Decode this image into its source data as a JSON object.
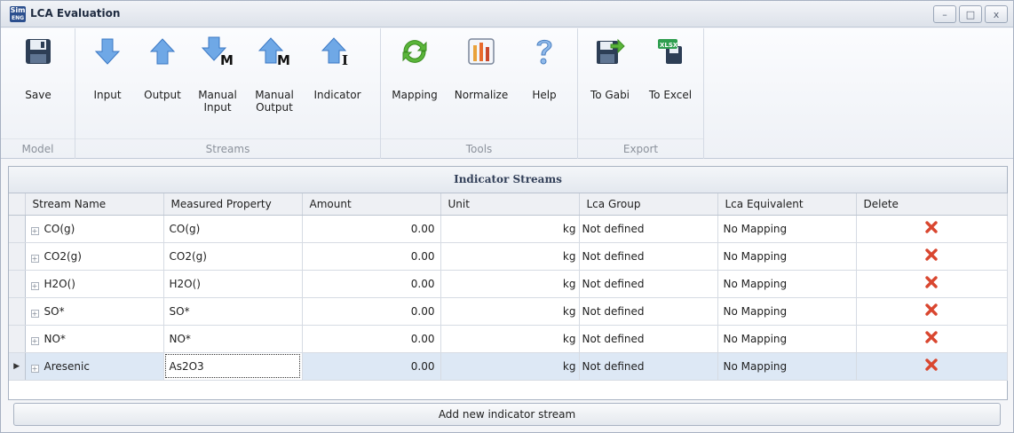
{
  "window": {
    "app_logo_top": "Sim",
    "app_logo_bottom": "ENG",
    "title": "LCA Evaluation"
  },
  "ribbon": {
    "groups": [
      {
        "caption": "Model",
        "buttons": [
          {
            "label": "Save",
            "icon": "save-icon"
          }
        ]
      },
      {
        "caption": "Streams",
        "buttons": [
          {
            "label": "Input",
            "icon": "arrow-down-icon"
          },
          {
            "label": "Output",
            "icon": "arrow-up-icon"
          },
          {
            "label": "Manual\nInput",
            "icon": "arrow-down-m-icon"
          },
          {
            "label": "Manual\nOutput",
            "icon": "arrow-up-m-icon"
          },
          {
            "label": "Indicator",
            "icon": "arrow-up-i-icon"
          }
        ]
      },
      {
        "caption": "Tools",
        "buttons": [
          {
            "label": "Mapping",
            "icon": "refresh-icon"
          },
          {
            "label": "Normalize",
            "icon": "bar-chart-icon"
          },
          {
            "label": "Help",
            "icon": "question-icon"
          }
        ]
      },
      {
        "caption": "Export",
        "buttons": [
          {
            "label": "To Gabi",
            "icon": "save-export-icon"
          },
          {
            "label": "To Excel",
            "icon": "excel-icon"
          }
        ]
      }
    ],
    "m_letter": "M",
    "i_letter": "I",
    "excel_badge": "XLSX"
  },
  "grid": {
    "title": "Indicator Streams",
    "columns": [
      "Stream Name",
      "Measured Property",
      "Amount",
      "Unit",
      "Lca Group",
      "Lca Equivalent",
      "Delete"
    ],
    "rows": [
      {
        "stream": "CO(g)",
        "property": "CO(g)",
        "amount": "0.00",
        "unit": "kg",
        "group": "Not defined",
        "equivalent": "No Mapping"
      },
      {
        "stream": "CO2(g)",
        "property": "CO2(g)",
        "amount": "0.00",
        "unit": "kg",
        "group": "Not defined",
        "equivalent": "No Mapping"
      },
      {
        "stream": "H2O()",
        "property": "H2O()",
        "amount": "0.00",
        "unit": "kg",
        "group": "Not defined",
        "equivalent": "No Mapping"
      },
      {
        "stream": "SO*",
        "property": "SO*",
        "amount": "0.00",
        "unit": "kg",
        "group": "Not defined",
        "equivalent": "No Mapping"
      },
      {
        "stream": "NO*",
        "property": "NO*",
        "amount": "0.00",
        "unit": "kg",
        "group": "Not defined",
        "equivalent": "No Mapping"
      },
      {
        "stream": "Aresenic",
        "property": "As2O3",
        "amount": "0.00",
        "unit": "kg",
        "group": "Not defined",
        "equivalent": "No Mapping"
      }
    ],
    "selected_row": 5,
    "row_indicator_glyph": "▶",
    "expander_glyph": "+",
    "delete_icon": "delete-x-icon",
    "delete_color": "#d9462f"
  },
  "add_button": {
    "label": "Add new indicator stream"
  },
  "window_buttons": {
    "minimize": "–",
    "maximize": "□",
    "close": "x"
  }
}
